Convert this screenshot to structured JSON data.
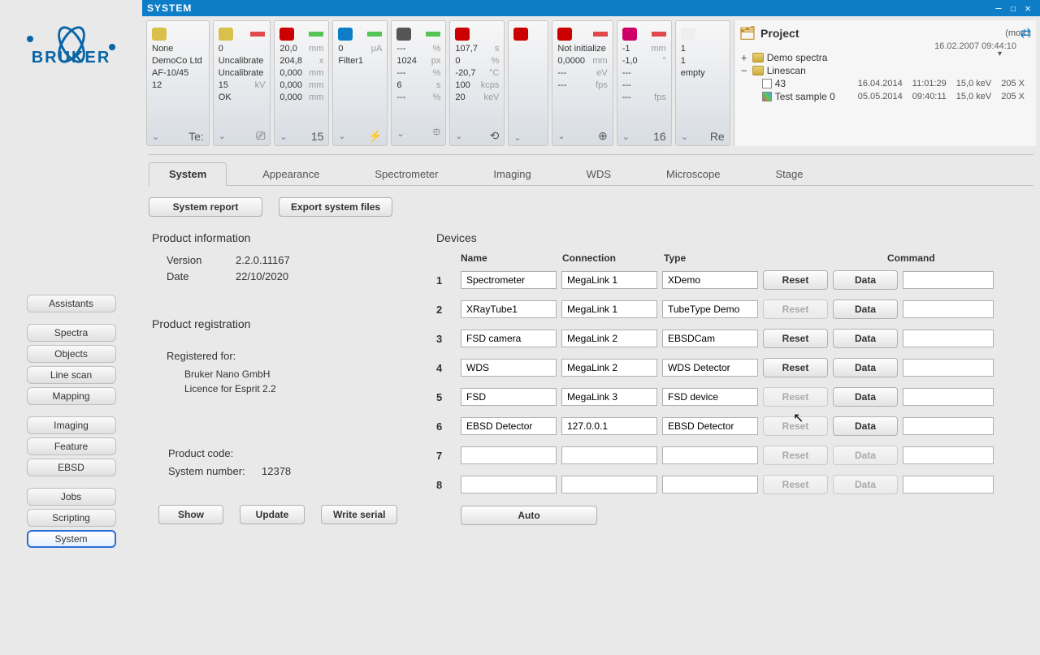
{
  "window": {
    "title": "SYSTEM",
    "min": "—",
    "max": "☐",
    "close": "✕"
  },
  "logo_text": "BRUKER",
  "left_nav": {
    "groups": [
      {
        "items": [
          {
            "label": "Assistants"
          }
        ]
      },
      {
        "items": [
          {
            "label": "Spectra"
          },
          {
            "label": "Objects"
          },
          {
            "label": "Line scan"
          },
          {
            "label": "Mapping"
          }
        ]
      },
      {
        "items": [
          {
            "label": "Imaging"
          },
          {
            "label": "Feature"
          },
          {
            "label": "EBSD"
          }
        ]
      },
      {
        "items": [
          {
            "label": "Jobs"
          },
          {
            "label": "Scripting"
          },
          {
            "label": "System",
            "selected": true
          }
        ]
      }
    ]
  },
  "panels": [
    {
      "icon_color": "#d9c04a",
      "bar": "",
      "rows": [
        [
          "None",
          ""
        ],
        [
          "DemoCo Ltd",
          ""
        ],
        [
          "AF-10/45",
          ""
        ],
        [
          "12",
          ""
        ]
      ],
      "footer": "Te:"
    },
    {
      "icon_color": "#d9c04a",
      "bar": "red",
      "rows": [
        [
          "0",
          ""
        ],
        [
          "Uncalibrate",
          ""
        ],
        [
          "Uncalibrate",
          ""
        ],
        [
          "15",
          "kV"
        ],
        [
          "OK",
          ""
        ]
      ],
      "footer": "⎚"
    },
    {
      "icon_color": "#c00",
      "bar": "green",
      "rows": [
        [
          "20,0",
          "mm"
        ],
        [
          "204,8",
          "x"
        ],
        [
          "0,000",
          "mm"
        ],
        [
          "0,000",
          "mm"
        ],
        [
          "0,000",
          "mm"
        ]
      ],
      "footer": "15"
    },
    {
      "icon_color": "#0d7dc7",
      "bar": "green",
      "rows": [
        [
          "0",
          "μA"
        ],
        [
          "Filter1",
          ""
        ]
      ],
      "footer": "⚡",
      "red_first": true
    },
    {
      "icon_color": "#555",
      "bar": "green",
      "rows": [
        [
          "---",
          "%"
        ],
        [
          "1024",
          "px"
        ],
        [
          "---",
          "%"
        ],
        [
          "6",
          "s"
        ],
        [
          "---",
          "%"
        ]
      ],
      "footer": "⯐"
    },
    {
      "icon_color": "#c00",
      "bar": "",
      "rows": [
        [
          "107,7",
          "s"
        ],
        [
          "0",
          "%"
        ],
        [
          "-20,7",
          "°C"
        ],
        [
          "100",
          "kcps"
        ],
        [
          "20",
          "keV"
        ]
      ],
      "footer": "⟲",
      "green_mid": true
    },
    {
      "icon_color": "#c00",
      "bar": "",
      "rows": [
        [
          "",
          ""
        ]
      ],
      "footer": "",
      "thin": true
    },
    {
      "icon_color": "#c00",
      "bar": "red",
      "rows": [
        [
          "Not initialize",
          ""
        ],
        [
          "",
          ""
        ],
        [
          "0,0000",
          "mm"
        ],
        [
          "---",
          "eV"
        ],
        [
          "---",
          "fps"
        ]
      ],
      "footer": "⊕"
    },
    {
      "icon_color": "#c06",
      "bar": "red",
      "rows": [
        [
          "-1",
          "mm"
        ],
        [
          "-1,0",
          "°"
        ],
        [
          "---",
          ""
        ],
        [
          "---",
          ""
        ],
        [
          "---",
          "fps"
        ]
      ],
      "footer": "16"
    },
    {
      "icon_color": "#eee",
      "bar": "",
      "rows": [
        [
          "1",
          ""
        ],
        [
          "1",
          ""
        ],
        [
          "empty",
          ""
        ]
      ],
      "footer": "Re"
    }
  ],
  "project": {
    "title": "Project",
    "mod": "(mod.)",
    "date": "16.02.2007 09:44:10",
    "tree": [
      {
        "type": "folder",
        "label": "Demo spectra",
        "exp": "+"
      },
      {
        "type": "folder",
        "label": "Linescan",
        "exp": "−",
        "children": [
          {
            "icon": "bw",
            "label": "43",
            "cols": [
              "16.04.2014",
              "11:01:29",
              "15,0 keV",
              "205 X"
            ]
          },
          {
            "icon": "grid",
            "label": "Test sample 0",
            "cols": [
              "05.05.2014",
              "09:40:11",
              "15,0 keV",
              "205 X"
            ]
          }
        ]
      }
    ]
  },
  "tabs": [
    "System",
    "Appearance",
    "Spectrometer",
    "Imaging",
    "WDS",
    "Microscope",
    "Stage"
  ],
  "active_tab": 0,
  "actions": {
    "report": "System report",
    "export": "Export system files"
  },
  "product_info": {
    "title": "Product information",
    "version_label": "Version",
    "version": "2.2.0.11167",
    "date_label": "Date",
    "date": "22/10/2020"
  },
  "registration": {
    "title": "Product registration",
    "for_label": "Registered for:",
    "line1": "Bruker Nano GmbH",
    "line2": "Licence for Esprit 2.2",
    "code_label": "Product code:",
    "sysnum_label": "System number:",
    "sysnum": "12378"
  },
  "reg_buttons": {
    "show": "Show",
    "update": "Update",
    "write": "Write serial"
  },
  "devices": {
    "title": "Devices",
    "headers": [
      "Name",
      "Connection",
      "Type",
      "",
      "Command"
    ],
    "rows": [
      {
        "idx": "1",
        "name": "Spectrometer",
        "conn": "MegaLink 1",
        "type": "XDemo",
        "reset_enabled": true,
        "data_enabled": true
      },
      {
        "idx": "2",
        "name": "XRayTube1",
        "conn": "MegaLink 1",
        "type": "TubeType Demo",
        "reset_enabled": false,
        "data_enabled": true
      },
      {
        "idx": "3",
        "name": "FSD camera",
        "conn": "MegaLink 2",
        "type": "EBSDCam",
        "reset_enabled": true,
        "data_enabled": true
      },
      {
        "idx": "4",
        "name": "WDS",
        "conn": "MegaLink 2",
        "type": "WDS Detector",
        "reset_enabled": true,
        "data_enabled": true
      },
      {
        "idx": "5",
        "name": "FSD",
        "conn": "MegaLink 3",
        "type": "FSD device",
        "reset_enabled": false,
        "data_enabled": true
      },
      {
        "idx": "6",
        "name": "EBSD Detector",
        "conn": "127.0.0.1",
        "type": "EBSD Detector",
        "reset_enabled": false,
        "data_enabled": true
      },
      {
        "idx": "7",
        "name": "",
        "conn": "",
        "type": "",
        "reset_enabled": false,
        "data_enabled": false
      },
      {
        "idx": "8",
        "name": "",
        "conn": "",
        "type": "",
        "reset_enabled": false,
        "data_enabled": false
      }
    ],
    "reset_label": "Reset",
    "data_label": "Data",
    "auto": "Auto"
  }
}
